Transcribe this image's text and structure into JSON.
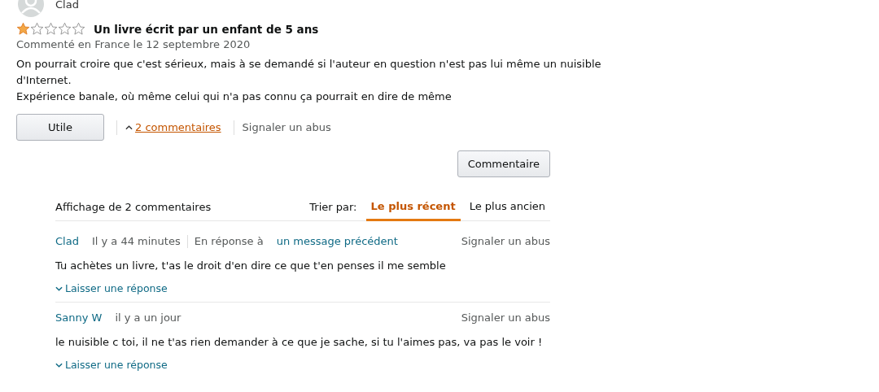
{
  "review": {
    "author": "Clad",
    "stars": 1,
    "title": "Un livre écrit par un enfant de 5 ans",
    "date": "Commenté en France le 12 septembre 2020",
    "paragraphs": [
      "On pourrait croire que c'est sérieux, mais à se demandé si l'auteur en question n'est pas lui même un nuisible d'Internet.",
      "Expérience banale, où même celui qui n'a pas connu ça pourrait en dire de même"
    ],
    "helpful_button": "Utile",
    "comments_link": "2 commentaires",
    "report_link": "Signaler un abus"
  },
  "comment_button": "Commentaire",
  "comments_section": {
    "count_label": "Affichage de 2 commentaires",
    "sort_label": "Trier par:",
    "sort_options": [
      {
        "label": "Le plus récent",
        "selected": true
      },
      {
        "label": "Le plus ancien",
        "selected": false
      }
    ],
    "comments": [
      {
        "author": "Clad",
        "time": "Il y a 44 minutes",
        "reply_prefix": "En réponse à",
        "reply_link": "un message précédent",
        "report": "Signaler un abus",
        "text": "Tu achètes un livre, t'as le droit d'en dire ce que t'en penses il me semble",
        "reply_action": "Laisser une réponse"
      },
      {
        "author": "Sanny W",
        "time": "il y a un jour",
        "report": "Signaler un abus",
        "text": "le nuisible c toi, il ne t'as rien demander à ce que je sache, si tu l'aimes pas, va pas le voir !",
        "reply_action": "Laisser une réponse"
      }
    ]
  }
}
